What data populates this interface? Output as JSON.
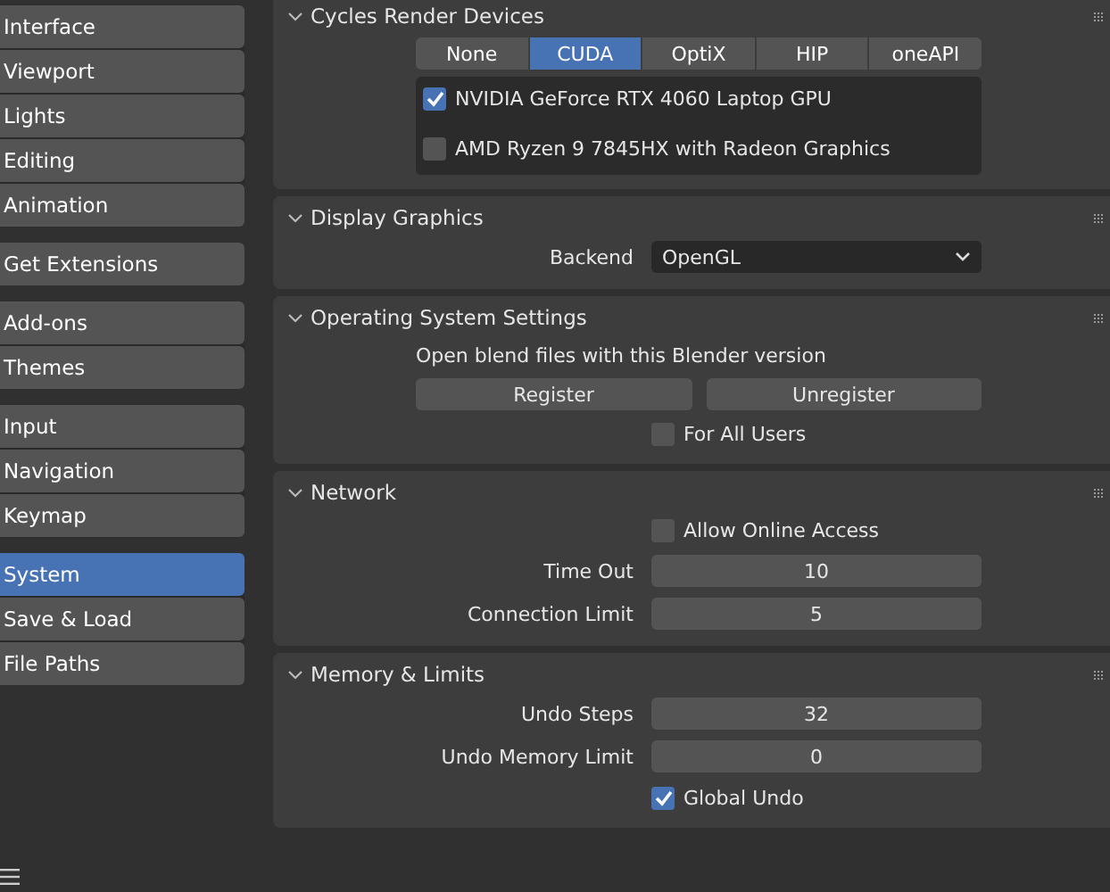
{
  "sidebar": {
    "groups": [
      [
        {
          "label": "Interface",
          "selected": false
        },
        {
          "label": "Viewport",
          "selected": false
        },
        {
          "label": "Lights",
          "selected": false
        },
        {
          "label": "Editing",
          "selected": false
        },
        {
          "label": "Animation",
          "selected": false
        }
      ],
      [
        {
          "label": "Get Extensions",
          "selected": false
        }
      ],
      [
        {
          "label": "Add-ons",
          "selected": false
        },
        {
          "label": "Themes",
          "selected": false
        }
      ],
      [
        {
          "label": "Input",
          "selected": false
        },
        {
          "label": "Navigation",
          "selected": false
        },
        {
          "label": "Keymap",
          "selected": false
        }
      ],
      [
        {
          "label": "System",
          "selected": true
        },
        {
          "label": "Save & Load",
          "selected": false
        },
        {
          "label": "File Paths",
          "selected": false
        }
      ]
    ]
  },
  "sections": [
    {
      "title": "Cycles Render Devices",
      "expanded": true,
      "rows": [
        {
          "kind": "segmented",
          "options": [
            {
              "label": "None",
              "selected": false
            },
            {
              "label": "CUDA",
              "selected": true
            },
            {
              "label": "OptiX",
              "selected": false
            },
            {
              "label": "HIP",
              "selected": false
            },
            {
              "label": "oneAPI",
              "selected": false
            }
          ]
        },
        {
          "kind": "device_list",
          "items": [
            {
              "label": "NVIDIA GeForce RTX 4060 Laptop GPU",
              "checked": true
            },
            {
              "label": "AMD Ryzen 9 7845HX with Radeon Graphics",
              "checked": false
            }
          ]
        }
      ]
    },
    {
      "title": "Display Graphics",
      "expanded": true,
      "rows": [
        {
          "kind": "dropdown",
          "label": "Backend",
          "value": "OpenGL"
        }
      ]
    },
    {
      "title": "Operating System Settings",
      "expanded": true,
      "rows": [
        {
          "kind": "text",
          "label": "Open blend files with this Blender version"
        },
        {
          "kind": "buttons",
          "items": [
            "Register",
            "Unregister"
          ]
        },
        {
          "kind": "checkbox",
          "label": "For All Users",
          "checked": false
        }
      ]
    },
    {
      "title": "Network",
      "expanded": true,
      "rows": [
        {
          "kind": "checkbox",
          "label": "Allow Online Access",
          "checked": false
        },
        {
          "kind": "number",
          "label": "Time Out",
          "value": "10"
        },
        {
          "kind": "number",
          "label": "Connection Limit",
          "value": "5"
        }
      ]
    },
    {
      "title": "Memory & Limits",
      "expanded": true,
      "rows": [
        {
          "kind": "number",
          "label": "Undo Steps",
          "value": "32"
        },
        {
          "kind": "number",
          "label": "Undo Memory Limit",
          "value": "0"
        },
        {
          "kind": "checkbox",
          "label": "Global Undo",
          "checked": true
        }
      ]
    }
  ]
}
